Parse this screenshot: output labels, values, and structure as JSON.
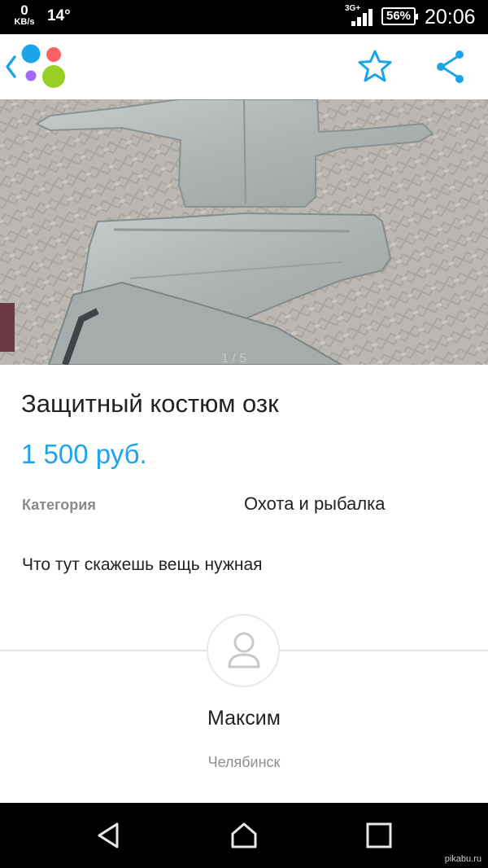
{
  "status_bar": {
    "net_speed_value": "0",
    "net_speed_unit": "KB/s",
    "temperature": "14°",
    "network_type": "3G+",
    "battery": "56%",
    "time": "20:06"
  },
  "app_bar": {
    "back_icon": "chevron-left-icon",
    "logo_icon": "avito-logo-icon",
    "favorite_icon": "star-icon",
    "share_icon": "share-icon",
    "logo_colors": [
      "#1ca4e8",
      "#ff6163",
      "#a169f7",
      "#97cf26"
    ]
  },
  "listing": {
    "photo_counter": "1 / 5",
    "title": "Защитный костюм озк",
    "price": "1 500 руб.",
    "category_label": "Категория",
    "category_value": "Охота и рыбалка",
    "description": "Что тут скажешь вещь нужная"
  },
  "seller": {
    "avatar_icon": "user-avatar-icon",
    "name": "Максим",
    "city": "Челябинск"
  },
  "nav_bar": {
    "back_icon": "nav-back-icon",
    "home_icon": "nav-home-icon",
    "recents_icon": "nav-recents-icon"
  },
  "watermark": "pikabu.ru",
  "colors": {
    "accent": "#1ca4e8",
    "text": "#222222",
    "muted": "#8a8a8a"
  }
}
